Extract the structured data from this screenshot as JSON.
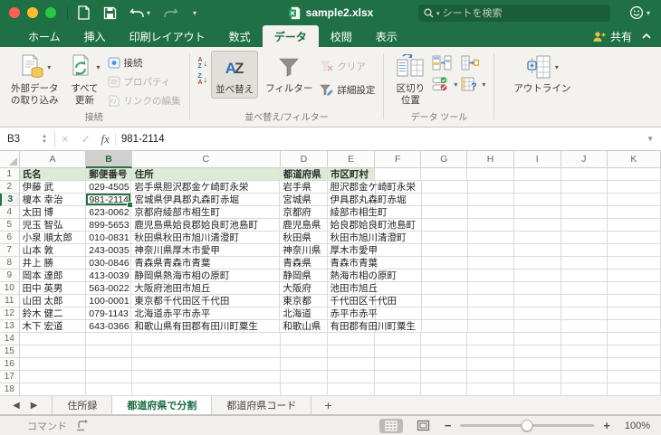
{
  "titlebar": {
    "title": "sample2.xlsx",
    "search_placeholder": "シートを検索"
  },
  "ribbon_tabs": {
    "items": [
      {
        "id": "home",
        "label": "ホーム",
        "active": false
      },
      {
        "id": "insert",
        "label": "挿入",
        "active": false
      },
      {
        "id": "page-layout",
        "label": "印刷レイアウト",
        "active": false
      },
      {
        "id": "formulas",
        "label": "数式",
        "active": false
      },
      {
        "id": "data",
        "label": "データ",
        "active": true
      },
      {
        "id": "review",
        "label": "校閲",
        "active": false
      },
      {
        "id": "view",
        "label": "表示",
        "active": false
      }
    ],
    "share_label": "共有"
  },
  "ribbon": {
    "get_external_label": "外部データ\nの取り込み",
    "refresh_all_label": "すべて\n更新",
    "connections_label": "接続",
    "properties_label": "プロパティ",
    "edit_links_label": "リンクの編集",
    "connections_group_label": "接続",
    "sort_label": "並べ替え",
    "filter_label": "フィルター",
    "clear_label": "クリア",
    "advanced_label": "詳細設定",
    "sort_filter_group_label": "並べ替え/フィルター",
    "text_to_columns_label": "区切り\n位置",
    "data_tools_group_label": "データ ツール",
    "outline_label": "アウトライン"
  },
  "formula_bar": {
    "name_box": "B3",
    "fx": "fx",
    "value": "981-2114"
  },
  "grid": {
    "columns": [
      "A",
      "B",
      "C",
      "D",
      "E",
      "F",
      "G",
      "H",
      "I",
      "J",
      "K"
    ],
    "selected_column": "B",
    "selected_row": 3,
    "selected_cell": "B3",
    "visible_row_count": 18,
    "header_row": [
      "氏名",
      "郵便番号",
      "住所",
      "都道府県",
      "市区町村"
    ],
    "rows": [
      {
        "name": "伊藤 武",
        "zip": "029-4505",
        "address": "岩手県胆沢郡金ケ崎町永栄",
        "pref": "岩手県",
        "city": "胆沢郡金ケ崎町永栄"
      },
      {
        "name": "榎本 幸治",
        "zip": "981-2114",
        "address": "宮城県伊具郡丸森町赤堀",
        "pref": "宮城県",
        "city": "伊具郡丸森町赤堀"
      },
      {
        "name": "太田 博",
        "zip": "623-0062",
        "address": "京都府綾部市相生町",
        "pref": "京都府",
        "city": "綾部市相生町"
      },
      {
        "name": "児玉 智弘",
        "zip": "899-5653",
        "address": "鹿児島県姶良郡姶良町池島町",
        "pref": "鹿児島県",
        "city": "姶良郡姶良町池島町"
      },
      {
        "name": "小泉 順太郎",
        "zip": "010-0831",
        "address": "秋田県秋田市旭川清澄町",
        "pref": "秋田県",
        "city": "秋田市旭川清澄町"
      },
      {
        "name": "山本 敦",
        "zip": "243-0035",
        "address": "神奈川県厚木市愛甲",
        "pref": "神奈川県",
        "city": "厚木市愛甲"
      },
      {
        "name": "井上 勝",
        "zip": "030-0846",
        "address": "青森県青森市青葉",
        "pref": "青森県",
        "city": "青森市青葉"
      },
      {
        "name": "岡本 達郎",
        "zip": "413-0039",
        "address": "静岡県熱海市相の原町",
        "pref": "静岡県",
        "city": "熱海市相の原町"
      },
      {
        "name": "田中 英男",
        "zip": "563-0022",
        "address": "大阪府池田市旭丘",
        "pref": "大阪府",
        "city": "池田市旭丘"
      },
      {
        "name": "山田 太郎",
        "zip": "100-0001",
        "address": "東京都千代田区千代田",
        "pref": "東京都",
        "city": "千代田区千代田"
      },
      {
        "name": "鈴木 健二",
        "zip": "079-1143",
        "address": "北海道赤平市赤平",
        "pref": "北海道",
        "city": "赤平市赤平"
      },
      {
        "name": "木下 宏道",
        "zip": "643-0366",
        "address": "和歌山県有田郡有田川町粟生",
        "pref": "和歌山県",
        "city": "有田郡有田川町粟生"
      }
    ]
  },
  "sheet_tabs": {
    "items": [
      {
        "label": "住所録",
        "active": false
      },
      {
        "label": "都道府県で分割",
        "active": true
      },
      {
        "label": "都道府県コード",
        "active": false
      }
    ],
    "add_label": "+"
  },
  "status_bar": {
    "command_label": "コマンド",
    "zoom_level": "100%"
  },
  "colors": {
    "excel_green": "#1f7145",
    "selection_green": "#217346",
    "header_fill_green": "#dcebd5"
  }
}
